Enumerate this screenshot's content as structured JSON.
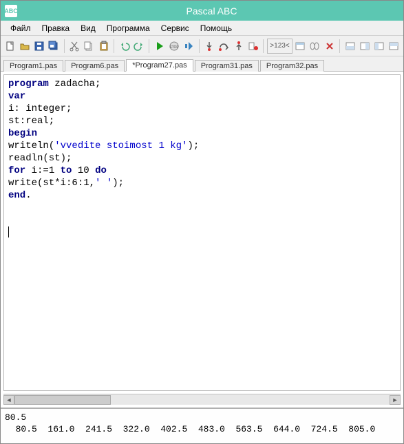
{
  "title": "Pascal ABC",
  "menu": {
    "file": "Файл",
    "edit": "Правка",
    "view": "Вид",
    "program": "Программа",
    "service": "Сервис",
    "help": "Помощь"
  },
  "tabs": [
    {
      "label": "Program1.pas",
      "active": false
    },
    {
      "label": "Program6.pas",
      "active": false
    },
    {
      "label": "*Program27.pas",
      "active": true
    },
    {
      "label": "Program31.pas",
      "active": false
    },
    {
      "label": "Program32.pas",
      "active": false
    }
  ],
  "code": {
    "l1_kw": "program",
    "l1_rest": " zadacha;",
    "l2_kw": "var",
    "l3": "i: integer;",
    "l4": "st:real;",
    "l5_kw": "begin",
    "l6_a": "writeln(",
    "l6_str": "'vvedite stoimost 1 kg'",
    "l6_b": ");",
    "l7": "readln(st);",
    "l8_a": "for",
    "l8_b": " i:=1 ",
    "l8_c": "to",
    "l8_d": " 10 ",
    "l8_e": "do",
    "l9_a": "write(st*i:6:1,",
    "l9_str": "' '",
    "l9_b": ");",
    "l10_kw": "end",
    "l10_rest": "."
  },
  "output": {
    "line1": "80.5",
    "line2": "  80.5  161.0  241.5  322.0  402.5  483.0  563.5  644.0  724.5  805.0"
  }
}
